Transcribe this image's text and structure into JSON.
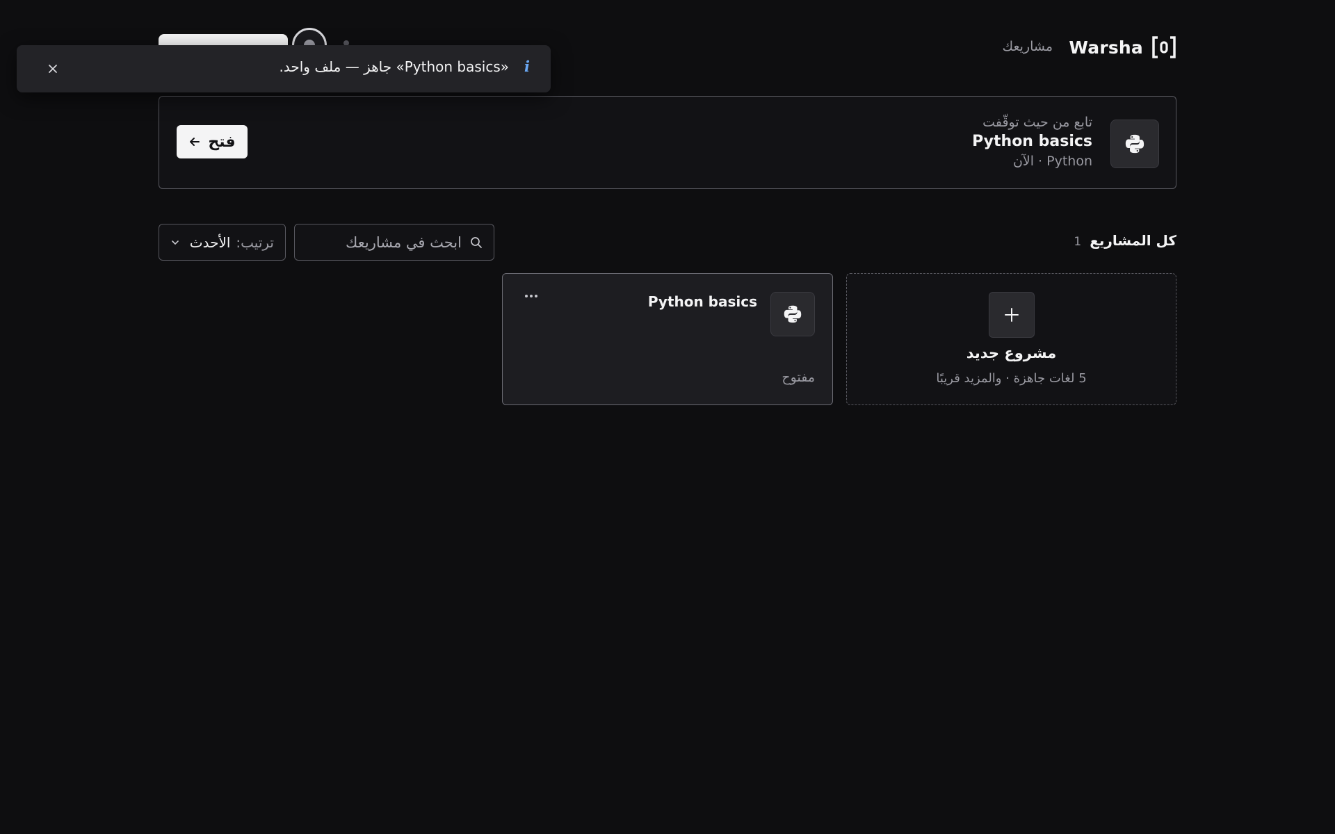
{
  "header": {
    "brand": "Warsha",
    "nav_projects": "مشاريعك"
  },
  "toast": {
    "message": "«Python basics» جاهز — ملف واحد.",
    "icon": "info-icon"
  },
  "continue_panel": {
    "eyebrow": "تابع من حيث توقّفت",
    "title": "Python basics",
    "meta": "Python · الآن",
    "open_label": "فتح",
    "icon": "python-icon"
  },
  "projects": {
    "section_title": "كل المشاريع",
    "count": "1",
    "search_placeholder": "ابحث في مشاريعك",
    "sort_label": "ترتيب:",
    "sort_value": "الأحدث"
  },
  "new_project_card": {
    "title": "مشروع جديد",
    "subtitle": "5 لغات جاهزة · والمزيد قريبًا",
    "icon": "plus-icon"
  },
  "project_cards": [
    {
      "title": "Python basics",
      "status": "مفتوح",
      "icon": "python-icon"
    }
  ],
  "colors": {
    "background": "#0e0e10",
    "surface": "#1d1d21",
    "border": "#58585f",
    "text": "#f4f4f5",
    "muted": "#9a9aa2",
    "info": "#6aa8f4"
  }
}
